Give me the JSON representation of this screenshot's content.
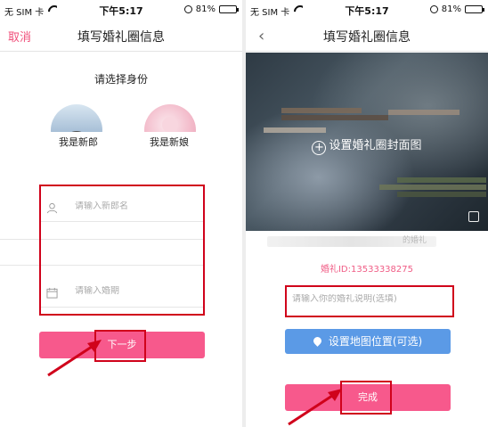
{
  "status": {
    "carrier": "无 SIM 卡",
    "time": "下午5:17",
    "battery": "81%",
    "battery_level": 0.81
  },
  "left": {
    "nav": {
      "title": "填写婚礼圈信息",
      "cancel": "取消"
    },
    "identity_title": "请选择身份",
    "roles": {
      "groom": "我是新郎",
      "bride": "我是新娘"
    },
    "fields": {
      "groom_placeholder": "请输入新郎名",
      "date_placeholder": "请输入婚期"
    },
    "next_button": "下一步"
  },
  "right": {
    "nav": {
      "title": "填写婚礼圈信息"
    },
    "cover_label": "设置婚礼圈封面图",
    "name_suffix": "的婚礼",
    "wedding_id": "婚礼ID:13533338275",
    "message_placeholder": "请输入你的婚礼说明(选填)",
    "map_button": "设置地图位置(可选)",
    "done_button": "完成"
  },
  "colors": {
    "accent_pink": "#f7598c",
    "cancel_pink": "#f04f7a",
    "map_blue": "#5b9ae6",
    "annotation_red": "#d0021b"
  }
}
